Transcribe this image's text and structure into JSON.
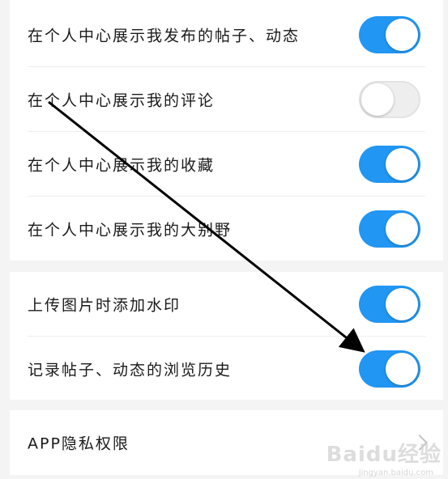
{
  "sections": [
    {
      "items": [
        {
          "label": "在个人中心展示我发布的帖子、动态",
          "enabled": true
        },
        {
          "label": "在个人中心展示我的评论",
          "enabled": false
        },
        {
          "label": "在个人中心展示我的收藏",
          "enabled": true
        },
        {
          "label": "在个人中心展示我的大别野",
          "enabled": true
        }
      ]
    },
    {
      "items": [
        {
          "label": "上传图片时添加水印",
          "enabled": true
        },
        {
          "label": "记录帖子、动态的浏览历史",
          "enabled": true
        }
      ]
    },
    {
      "items": [
        {
          "label": "APP隐私权限"
        }
      ]
    }
  ],
  "colors": {
    "accent": "#2196f3",
    "toggle_off": "#eeeeee",
    "background": "#f4f4f4"
  },
  "watermark": {
    "brand": "Baidu经验",
    "url": "jingyan.baidu.com"
  }
}
